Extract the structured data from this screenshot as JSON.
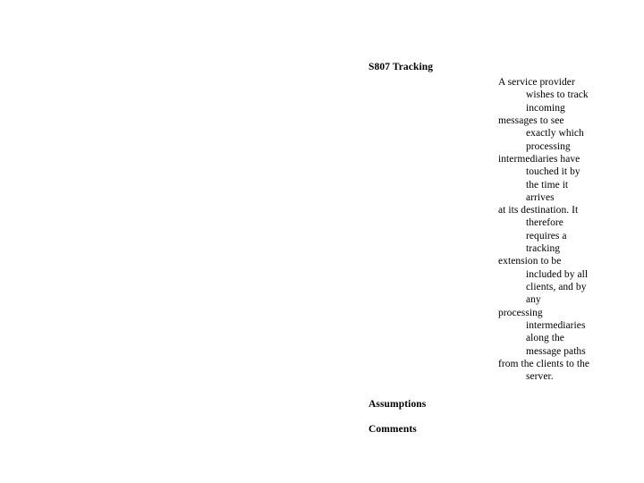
{
  "document": {
    "background_color": "#ffffff",
    "text_color": "#000000"
  },
  "section": {
    "title": "S807 Tracking",
    "assumptions_label": "Assumptions",
    "comments_label": "Comments"
  },
  "description": {
    "full_text": "A service provider wishes to track incoming messages to see exactly which processing intermediaries have touched it by the time it arrives at its destination. It therefore requires a tracking extension to be included by all clients, and by any processing intermediaries along the message paths from the clients to the server.",
    "lines": [
      {
        "text": "A service provider",
        "indent": "outdent"
      },
      {
        "text": "wishes to track",
        "indent": "indent"
      },
      {
        "text": "incoming",
        "indent": "indent"
      },
      {
        "text": "messages to see",
        "indent": "outdent"
      },
      {
        "text": "exactly which",
        "indent": "indent"
      },
      {
        "text": "processing",
        "indent": "indent"
      },
      {
        "text": "intermediaries have",
        "indent": "outdent"
      },
      {
        "text": "touched it by",
        "indent": "indent"
      },
      {
        "text": "the time it",
        "indent": "indent"
      },
      {
        "text": "arrives",
        "indent": "indent"
      },
      {
        "text": "at its destination. It",
        "indent": "outdent"
      },
      {
        "text": "therefore",
        "indent": "indent"
      },
      {
        "text": "requires a",
        "indent": "indent"
      },
      {
        "text": "tracking",
        "indent": "indent"
      },
      {
        "text": "extension to be",
        "indent": "outdent"
      },
      {
        "text": "included by all",
        "indent": "indent"
      },
      {
        "text": "clients, and by",
        "indent": "indent"
      },
      {
        "text": "any",
        "indent": "indent"
      },
      {
        "text": "processing",
        "indent": "outdent"
      },
      {
        "text": "intermediaries",
        "indent": "indent"
      },
      {
        "text": "along the",
        "indent": "indent"
      },
      {
        "text": "message paths",
        "indent": "indent"
      },
      {
        "text": "from the clients to the",
        "indent": "outdent"
      },
      {
        "text": "server.",
        "indent": "indent"
      }
    ]
  }
}
